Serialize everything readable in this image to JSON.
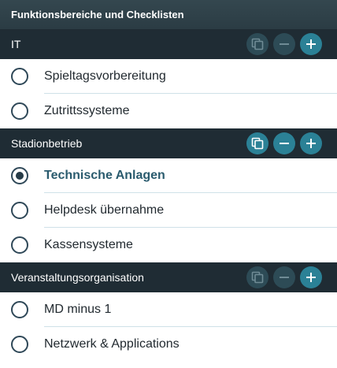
{
  "title": "Funktionsbereiche und Checklisten",
  "colors": {
    "title_bar": "#2f424a",
    "section_header": "#1f2c34",
    "button_active": "#2b8196",
    "button_muted": "#2d4b56",
    "selected_text": "#2a5b6e",
    "divider": "#cfe1e8"
  },
  "sections": [
    {
      "name": "IT",
      "actions": {
        "copy": {
          "icon": "copy-icon",
          "enabled": false
        },
        "remove": {
          "icon": "minus-icon",
          "enabled": false
        },
        "add": {
          "icon": "plus-icon",
          "enabled": true
        }
      },
      "items": [
        {
          "label": "Spieltagsvorbereitung",
          "selected": false
        },
        {
          "label": "Zutrittssysteme",
          "selected": false
        }
      ]
    },
    {
      "name": "Stadionbetrieb",
      "actions": {
        "copy": {
          "icon": "copy-icon",
          "enabled": true
        },
        "remove": {
          "icon": "minus-icon",
          "enabled": true
        },
        "add": {
          "icon": "plus-icon",
          "enabled": true
        }
      },
      "items": [
        {
          "label": "Technische Anlagen",
          "selected": true
        },
        {
          "label": "Helpdesk übernahme",
          "selected": false
        },
        {
          "label": "Kassensysteme",
          "selected": false
        }
      ]
    },
    {
      "name": "Veranstaltungsorganisation",
      "actions": {
        "copy": {
          "icon": "copy-icon",
          "enabled": false
        },
        "remove": {
          "icon": "minus-icon",
          "enabled": false
        },
        "add": {
          "icon": "plus-icon",
          "enabled": true
        }
      },
      "items": [
        {
          "label": "MD minus 1",
          "selected": false
        },
        {
          "label": "Netzwerk & Applications",
          "selected": false
        }
      ]
    }
  ]
}
